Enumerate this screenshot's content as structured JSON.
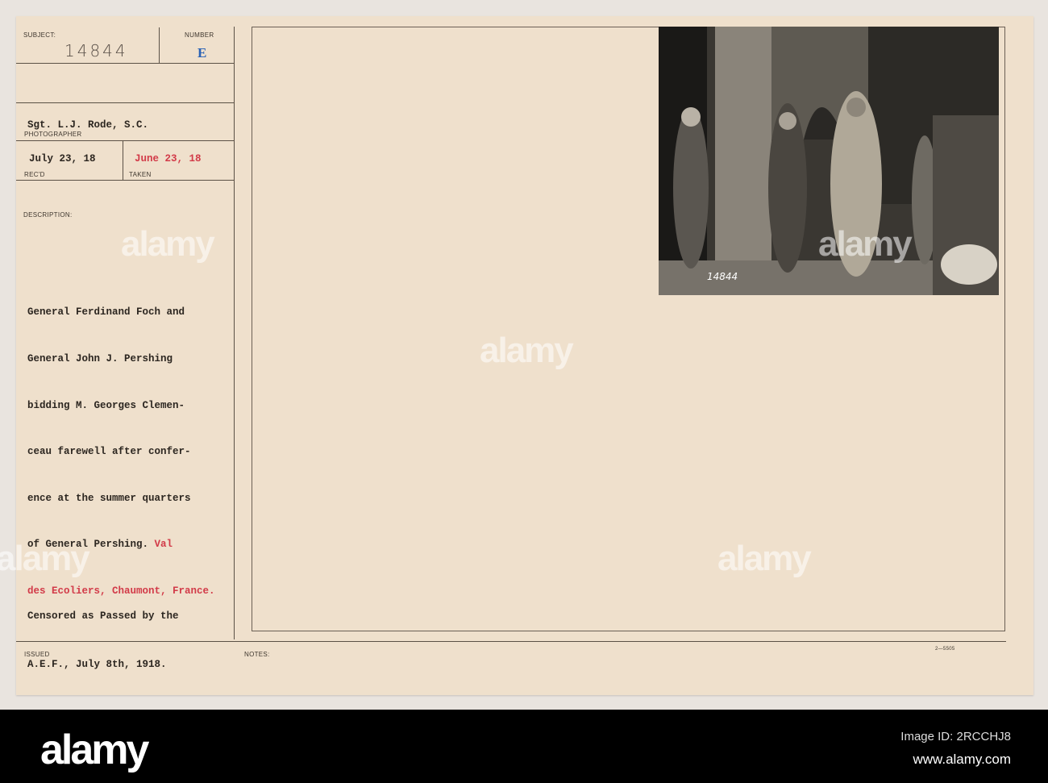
{
  "card": {
    "labels": {
      "subject": "SUBJECT:",
      "number": "NUMBER",
      "photographer": "PHOTOGRAPHER",
      "recd": "REC'D",
      "taken": "TAKEN",
      "description": "DESCRIPTION:",
      "issued": "ISSUED",
      "notes": "NOTES:"
    },
    "subject_number": "14844",
    "number_letter": "E",
    "photographer": "Sgt. L.J. Rode, S.C.",
    "recd_date": "July 23, 18",
    "taken_date": "June 23, 18",
    "description_lines": [
      "General Ferdinand Foch and",
      "General John J. Pershing",
      "bidding M. Georges Clemen-",
      "ceau farewell after confer-",
      "ence at the summer quarters",
      "of General Pershing."
    ],
    "description_red_1": "Val",
    "description_red_2": "des Ecoliers, Chaumont, France.",
    "censor_lines": [
      "Censored as Passed by the",
      "A.E.F., July 8th, 1918."
    ],
    "form_code": "2—5505",
    "photo_caption": "14844"
  },
  "watermark": {
    "text": "alamy"
  },
  "footer": {
    "logo": "alamy",
    "image_id": "Image ID: 2RCCHJ8",
    "url": "www.alamy.com"
  }
}
